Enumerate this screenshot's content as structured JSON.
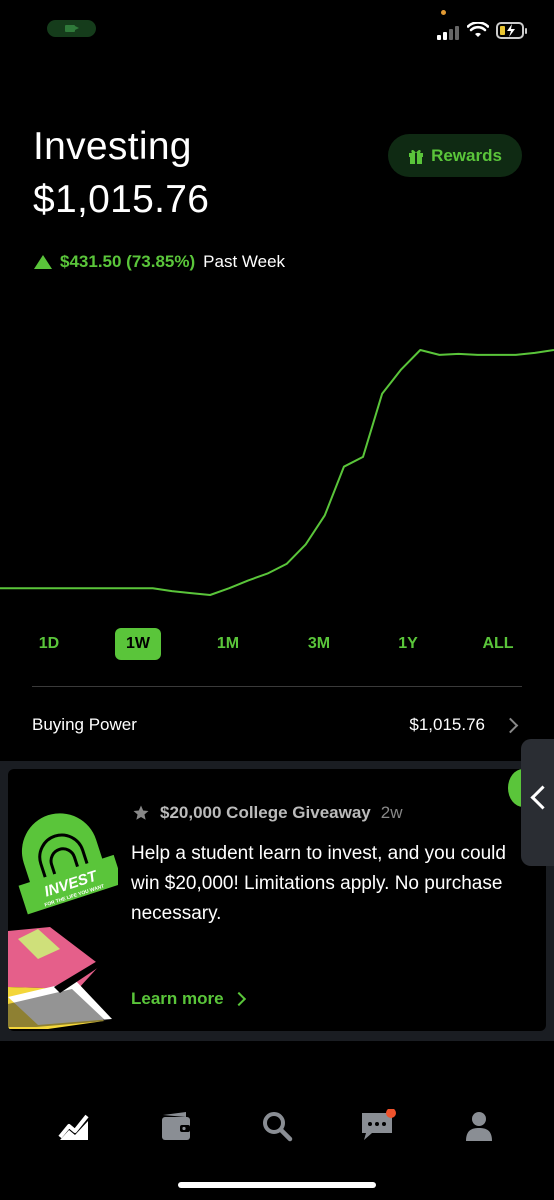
{
  "status_bar": {
    "icons": [
      "camera-icon",
      "signal-icon",
      "wifi-icon",
      "battery-charging-icon"
    ]
  },
  "header": {
    "title": "Investing",
    "portfolio_value": "$1,015.76",
    "rewards_label": "Rewards",
    "change": "$431.50 (73.85%)",
    "change_period": "Past Week",
    "accent_color": "#5ac53a"
  },
  "chart_data": {
    "type": "line",
    "title": "",
    "xlabel": "",
    "ylabel": "",
    "grid": false,
    "series": [
      {
        "values": [
          1,
          1,
          1,
          1,
          1,
          1,
          1,
          1,
          1,
          0.97,
          0.95,
          0.93,
          1.0,
          1.08,
          1.15,
          1.25,
          1.45,
          1.75,
          2.25,
          2.35,
          3.0,
          3.25,
          3.45,
          3.4,
          3.41,
          3.4,
          3.4,
          3.4,
          3.42,
          3.45
        ]
      }
    ]
  },
  "ranges": {
    "items": [
      "1D",
      "1W",
      "1M",
      "3M",
      "1Y",
      "ALL"
    ],
    "active": "1W"
  },
  "buying_power": {
    "label": "Buying Power",
    "value": "$1,015.76"
  },
  "news_card": {
    "source": "$20,000 College Giveaway",
    "age": "2w",
    "text": "Help a student learn to invest, and you could win $20,000! Limitations apply. No purchase necessary.",
    "link": "Learn more",
    "art_text": "INVEST",
    "art_subtext": "FOR THE LIFE YOU WANT"
  },
  "tabbar": {
    "items": [
      "chart-icon",
      "wallet-icon",
      "search-icon",
      "messages-icon",
      "account-icon"
    ]
  }
}
